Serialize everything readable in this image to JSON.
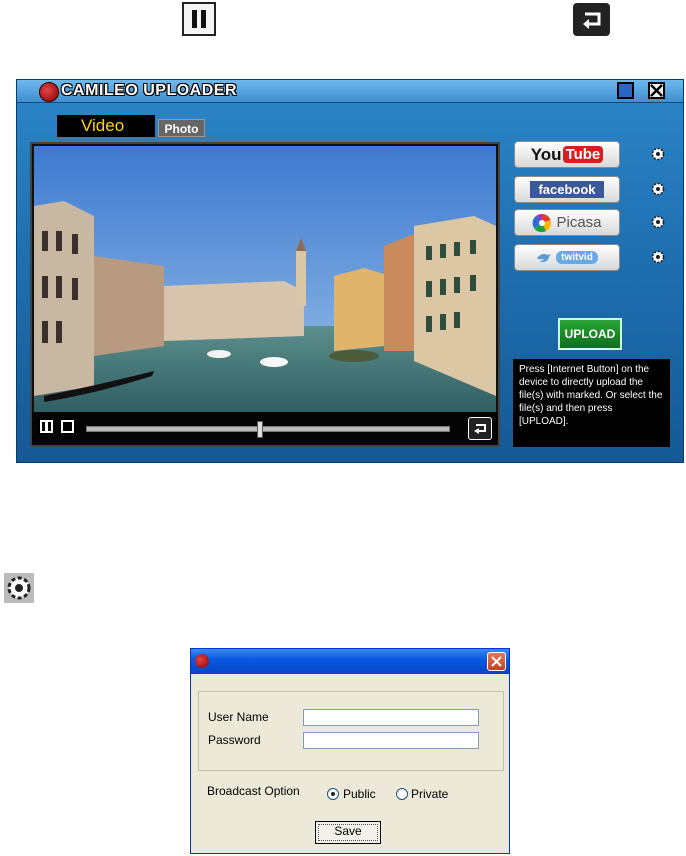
{
  "top_icons": {
    "pause": "pause-icon",
    "return": "return-icon"
  },
  "uploader": {
    "title": "CAMILEO UPLOADER",
    "tabs": [
      {
        "label": "Video",
        "active": true
      },
      {
        "label": "Photo",
        "active": false
      }
    ],
    "playback": {
      "progress": 0.47
    },
    "services": [
      {
        "name": "YouTube",
        "icon": "youtube-logo"
      },
      {
        "name": "facebook",
        "icon": "facebook-logo"
      },
      {
        "name": "Picasa",
        "icon": "picasa-logo"
      },
      {
        "name": "twitvid",
        "icon": "twitvid-logo"
      }
    ],
    "youtube": {
      "you": "You",
      "tube": "Tube"
    },
    "facebook_label": "facebook",
    "picasa_label": "Picasa",
    "twitvid_label": "twitvid",
    "upload_label": "UPLOAD",
    "info_text": "Press [Internet Button] on the device to directly upload the file(s) with marked. Or select the file(s) and then press [UPLOAD]."
  },
  "settings_icon": "gear-icon",
  "dialog": {
    "labels": {
      "username": "User Name",
      "password": "Password",
      "broadcast": "Broadcast Option"
    },
    "username_value": "",
    "password_value": "",
    "options": [
      {
        "label": "Public",
        "selected": true
      },
      {
        "label": "Private",
        "selected": false
      }
    ],
    "save_label": "Save"
  },
  "colors": {
    "accent": "#1f70b1",
    "upload_green": "#1a8a2a",
    "dialog_title": "#0a5ae1"
  }
}
